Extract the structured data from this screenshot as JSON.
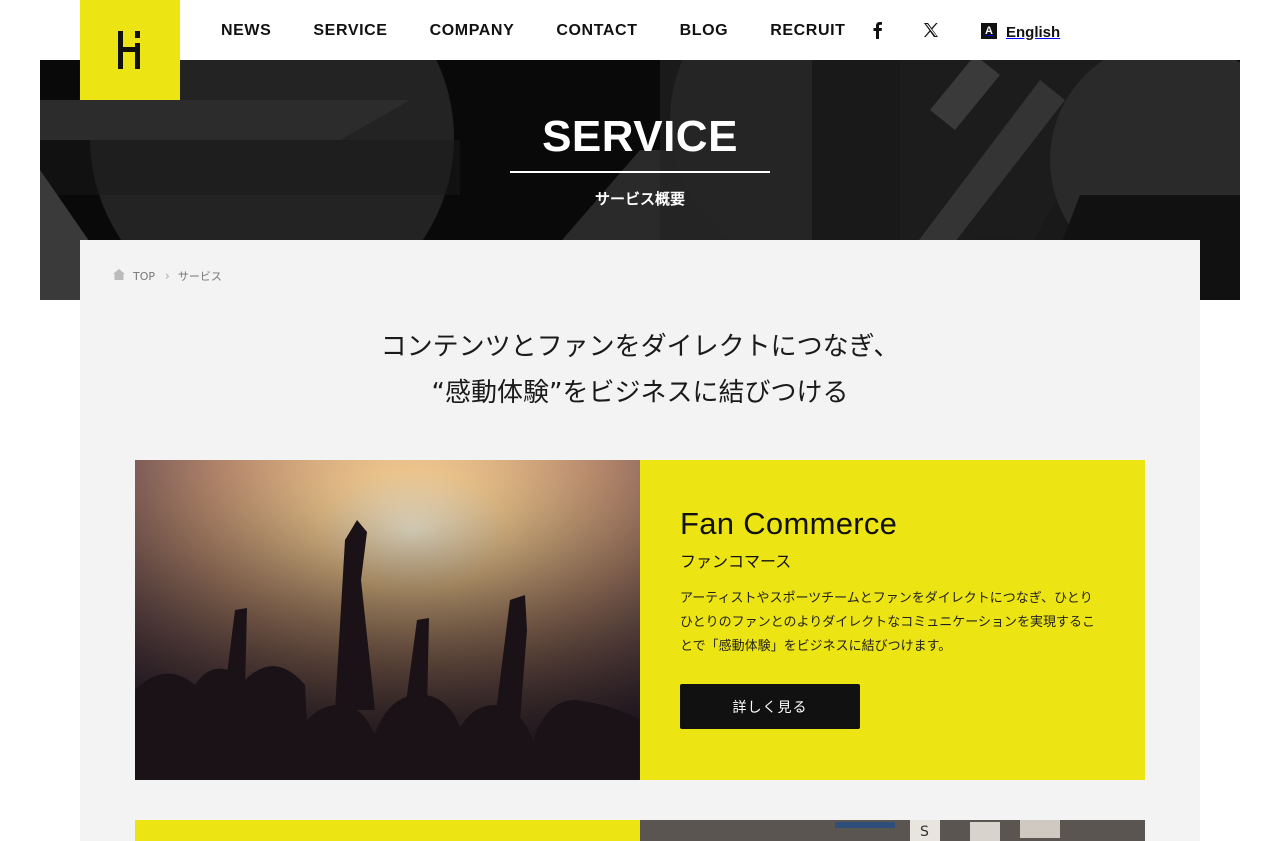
{
  "header": {
    "logo_alt": "H",
    "nav": [
      "NEWS",
      "SERVICE",
      "COMPANY",
      "CONTACT",
      "BLOG",
      "RECRUIT"
    ],
    "social": [
      {
        "name": "facebook-icon",
        "glyph": "f"
      },
      {
        "name": "x-icon",
        "glyph": "𝕏"
      }
    ],
    "lang": {
      "icon_letter": "A",
      "label": "English"
    }
  },
  "hero": {
    "title": "SERVICE",
    "subtitle": "サービス概要"
  },
  "breadcrumb": {
    "home": "TOP",
    "current": "サービス"
  },
  "lead": {
    "line1": "コンテンツとファンをダイレクトにつなぎ、",
    "line2": "“感動体験”をビジネスに結びつける"
  },
  "services": [
    {
      "title": "Fan Commerce",
      "subtitle": "ファンコマース",
      "description": "アーティストやスポーツチームとファンをダイレクトにつなぎ、ひとりひとりのファンとのよりダイレクトなコミュニケーションを実現することで「感動体験」をビジネスに結びつけます。",
      "button": "詳しく見る"
    }
  ],
  "colors": {
    "accent": "#ede414",
    "dark": "#111111",
    "panel": "#f3f3f3"
  }
}
